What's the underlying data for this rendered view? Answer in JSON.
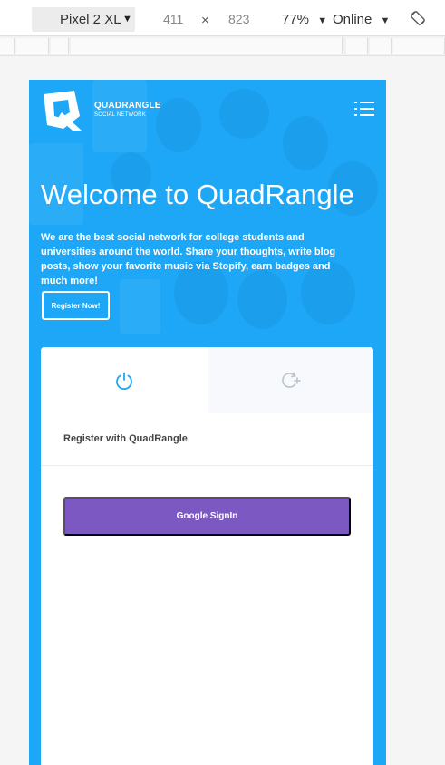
{
  "devtools": {
    "device": "Pixel 2 XL",
    "width": "411",
    "times": "×",
    "height": "823",
    "zoom": "77%",
    "throttle": "Online",
    "caret": "▼"
  },
  "header": {
    "brand": "QUADRANGLE",
    "brand_sub": "SOCIAL NETWORK"
  },
  "hero": {
    "title": "Welcome to QuadRangle",
    "text": "We are the best social network for college students and universities around the world. Share your thoughts, write blog posts, show your favorite music via Stopify, earn badges and much more!",
    "register_label": "Register Now!"
  },
  "card": {
    "section_title": "Register with QuadRangle",
    "google_label": "Google SignIn"
  },
  "icons": {
    "login_tab": "power-icon",
    "register_tab": "refresh-plus-icon",
    "menu": "menu-icon",
    "rotate": "rotate-icon"
  },
  "colors": {
    "brand_blue": "#1ea7f6",
    "google_purple": "#7c59c2",
    "icon_active": "#1ea7f6",
    "icon_inactive": "#b9c3cc"
  }
}
